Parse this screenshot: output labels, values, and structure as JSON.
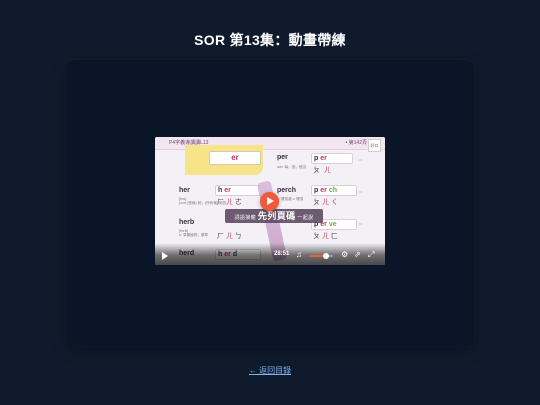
{
  "page": {
    "title": "SOR 第13集：動畫帶練"
  },
  "player": {
    "slide": {
      "header_title": "P4字義導讀讀L13",
      "header_page": "• 第142頁",
      "logo_text": "好口",
      "highlight_box": "er",
      "sticker_small_left": "詞語接龍",
      "sticker_big": "先列頁碼",
      "sticker_small_right": "一起說",
      "rows": [
        {
          "word": "her",
          "phonetic": "[hɚ]",
          "sub": "pron.(受格) 她；(所有格) 她的",
          "parts": [
            "h",
            "er"
          ],
          "zh": [
            "ㄏ",
            "ㄦ",
            "ㄜ"
          ],
          "rword": "perch",
          "rparts": [
            "p",
            "er",
            "ch"
          ],
          "rzh": [
            "ㄆ",
            "ㄦ",
            "ㄑ"
          ],
          "rsub": "n. 棲息處 v. 棲息"
        },
        {
          "word": "herb",
          "phonetic": "[hɝb]",
          "sub": "n. 草藥植物；藥草",
          "parts": [
            "h",
            "er",
            "b"
          ],
          "zh": [
            "ㄏ",
            "ㄦ",
            "ㄅ"
          ],
          "rword": "perve",
          "rparts": [
            "p",
            "er",
            "ve"
          ],
          "rzh": [
            "ㄆ",
            "ㄦ",
            "ㄈ"
          ],
          "rsub": ""
        },
        {
          "word": "herd",
          "phonetic": "",
          "sub": "",
          "parts": [
            "h",
            "er",
            "d"
          ],
          "zh": [],
          "rword": "",
          "rparts": [],
          "rzh": [],
          "rsub": ""
        }
      ],
      "top_right_word": "per",
      "top_right_zh": [
        "ㄆ",
        "ㄦ"
      ],
      "top_right_sub": "adv. 每；按；經由"
    },
    "controls": {
      "time": "28:51",
      "volume_level": 0.7,
      "icons": [
        "play-icon",
        "volume-icon",
        "settings-icon",
        "external-link-icon",
        "fullscreen-icon"
      ]
    }
  },
  "nav": {
    "back_label": "← 返回目錄"
  },
  "colors": {
    "background": "#0f1b2d",
    "panel": "#0a1627",
    "accent": "#ef5a3b",
    "link": "#7fb3f0"
  }
}
